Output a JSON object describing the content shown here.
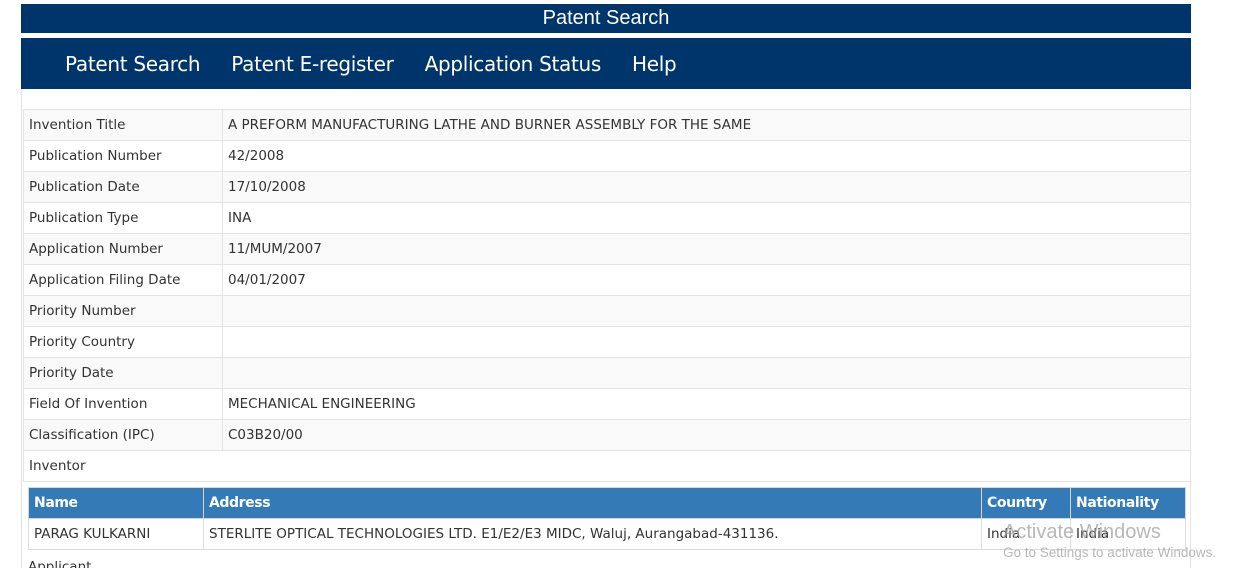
{
  "header": {
    "title": "Patent Search"
  },
  "nav": {
    "items": [
      {
        "label": "Patent Search"
      },
      {
        "label": "Patent E-register"
      },
      {
        "label": "Application Status"
      },
      {
        "label": "Help"
      }
    ]
  },
  "details": {
    "rows": [
      {
        "label": "Invention Title",
        "value": "A PREFORM MANUFACTURING LATHE AND BURNER ASSEMBLY FOR THE SAME"
      },
      {
        "label": "Publication Number",
        "value": "42/2008"
      },
      {
        "label": "Publication Date",
        "value": "17/10/2008"
      },
      {
        "label": "Publication Type",
        "value": "INA"
      },
      {
        "label": "Application Number",
        "value": "11/MUM/2007"
      },
      {
        "label": "Application Filing Date",
        "value": "04/01/2007"
      },
      {
        "label": "Priority Number",
        "value": ""
      },
      {
        "label": "Priority Country",
        "value": ""
      },
      {
        "label": "Priority Date",
        "value": ""
      },
      {
        "label": "Field Of Invention",
        "value": "MECHANICAL ENGINEERING"
      },
      {
        "label": "Classification (IPC)",
        "value": "C03B20/00"
      }
    ],
    "inventor_label": "Inventor"
  },
  "inventors": {
    "headers": {
      "name": "Name",
      "address": "Address",
      "country": "Country",
      "nationality": "Nationality"
    },
    "rows": [
      {
        "name": "PARAG KULKARNI",
        "address": "STERLITE OPTICAL TECHNOLOGIES LTD. E1/E2/E3 MIDC, Waluj, Aurangabad-431136.",
        "country": "India",
        "nationality": "India"
      }
    ]
  },
  "next_section": {
    "label": "Applicant"
  },
  "watermark": {
    "line1": "Activate Windows",
    "line2": "Go to Settings to activate Windows."
  },
  "colors": {
    "nav_bg": "#00356b",
    "table_header_bg": "#337ab7"
  }
}
